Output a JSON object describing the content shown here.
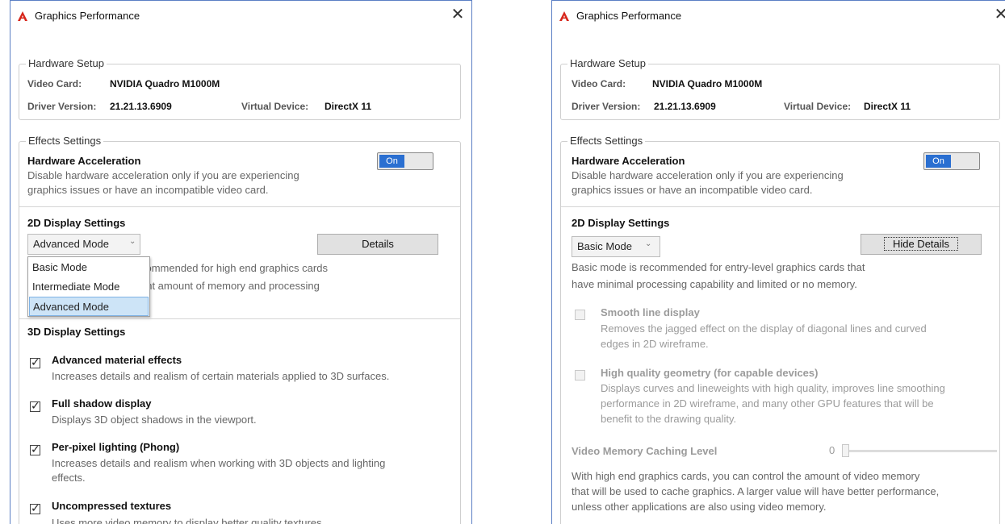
{
  "colors": {
    "accent": "#2a6fd1",
    "window_border": "#5a7fc4",
    "dropdown_selected": "#cde4f7"
  },
  "left": {
    "title": "Graphics Performance",
    "close_icon": "close-icon",
    "hardware": {
      "legend": "Hardware Setup",
      "video_card_label": "Video Card:",
      "video_card_value": "NVIDIA Quadro M1000M",
      "driver_label": "Driver Version:",
      "driver_value": "21.21.13.6909",
      "virtual_label": "Virtual Device:",
      "virtual_value": "DirectX 11"
    },
    "effects": {
      "legend": "Effects Settings",
      "hw_accel_title": "Hardware Acceleration",
      "hw_accel_desc_1": "Disable hardware acceleration only if you are experiencing",
      "hw_accel_desc_2": "graphics issues or have an incompatible video card.",
      "toggle_label": "On",
      "display2d_title": "2D Display Settings",
      "mode_value": "Advanced Mode",
      "details_button": "Details",
      "partial_desc_1": "commended for high end graphics cards",
      "partial_desc_2": "ant amount of memory and processing",
      "mode_options": [
        "Basic Mode",
        "Intermediate Mode",
        "Advanced Mode"
      ],
      "display3d_title": "3D Display Settings",
      "options": [
        {
          "title": "Advanced material effects",
          "desc": [
            "Increases details and realism of certain materials applied to 3D surfaces."
          ],
          "checked": true
        },
        {
          "title": "Full shadow display",
          "desc": [
            "Displays 3D object shadows in the viewport."
          ],
          "checked": true
        },
        {
          "title": "Per-pixel lighting (Phong)",
          "desc": [
            "Increases details and realism when working with 3D objects and lighting",
            "effects."
          ],
          "checked": true
        },
        {
          "title": "Uncompressed textures",
          "desc": [
            "Uses more video memory to display better quality textures."
          ],
          "checked": true
        }
      ]
    }
  },
  "right": {
    "title": "Graphics Performance",
    "hardware": {
      "legend": "Hardware Setup",
      "video_card_label": "Video Card:",
      "video_card_value": "NVIDIA Quadro M1000M",
      "driver_label": "Driver Version:",
      "driver_value": "21.21.13.6909",
      "virtual_label": "Virtual Device:",
      "virtual_value": "DirectX 11"
    },
    "effects": {
      "legend": "Effects Settings",
      "hw_accel_title": "Hardware Acceleration",
      "hw_accel_desc_1": "Disable hardware acceleration only if you are experiencing",
      "hw_accel_desc_2": "graphics issues or have an incompatible video card.",
      "toggle_label": "On",
      "display2d_title": "2D Display Settings",
      "mode_value": "Basic Mode",
      "hide_details_button": "Hide Details",
      "basic_desc_1": "Basic mode is recommended for entry-level graphics cards that",
      "basic_desc_2": "have minimal processing capability and limited or no memory.",
      "smooth_title": "Smooth line display",
      "smooth_desc_1": "Removes the jagged effect on the display of diagonal lines and curved",
      "smooth_desc_2": "edges in 2D wireframe.",
      "hq_title": "High quality geometry (for capable devices)",
      "hq_desc_1": "Displays curves and lineweights with high quality, improves line smoothing",
      "hq_desc_2": "performance in 2D wireframe, and many other GPU features that will be",
      "hq_desc_3": "benefit to the drawing quality.",
      "vm_title": "Video Memory Caching Level",
      "vm_value": "0",
      "vm_desc_1": "With high end graphics cards, you can control the amount of video memory",
      "vm_desc_2": "that will be used to cache graphics.  A larger value will have better performance,",
      "vm_desc_3": "unless other applications are also using video memory."
    }
  }
}
